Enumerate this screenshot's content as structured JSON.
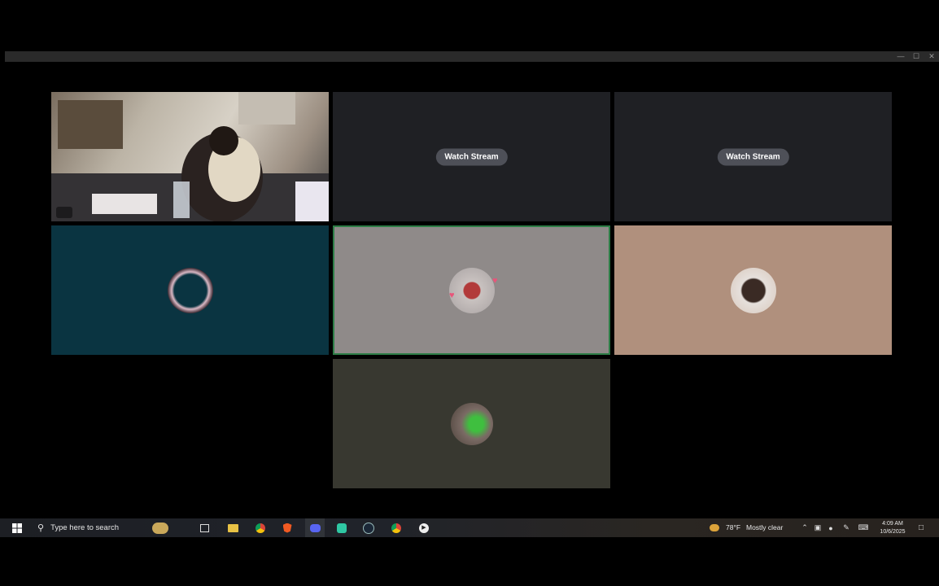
{
  "call": {
    "streams": [
      {
        "button_label": "Watch Stream"
      },
      {
        "button_label": "Watch Stream"
      }
    ]
  },
  "taskbar": {
    "search_placeholder": "Type here to search",
    "pinned_icons": [
      "widgets-icon",
      "task-view-icon",
      "file-explorer-icon",
      "chrome-icon",
      "brave-icon",
      "discord-icon",
      "app-icon",
      "steam-icon",
      "chrome-icon",
      "media-player-icon"
    ],
    "weather": {
      "temperature": "78°F",
      "condition": "Mostly clear"
    },
    "clock": {
      "time": "4:09 AM",
      "date": "10/6/2025"
    }
  },
  "colors": {
    "tile_teal": "#0a3441",
    "tile_gray": "#8f8a89",
    "tile_tan": "#b0907d",
    "tile_olive": "#383830",
    "stream_bg": "#1f2024",
    "speaking_border": "#2d7d46",
    "button_bg": "#4e5058"
  }
}
